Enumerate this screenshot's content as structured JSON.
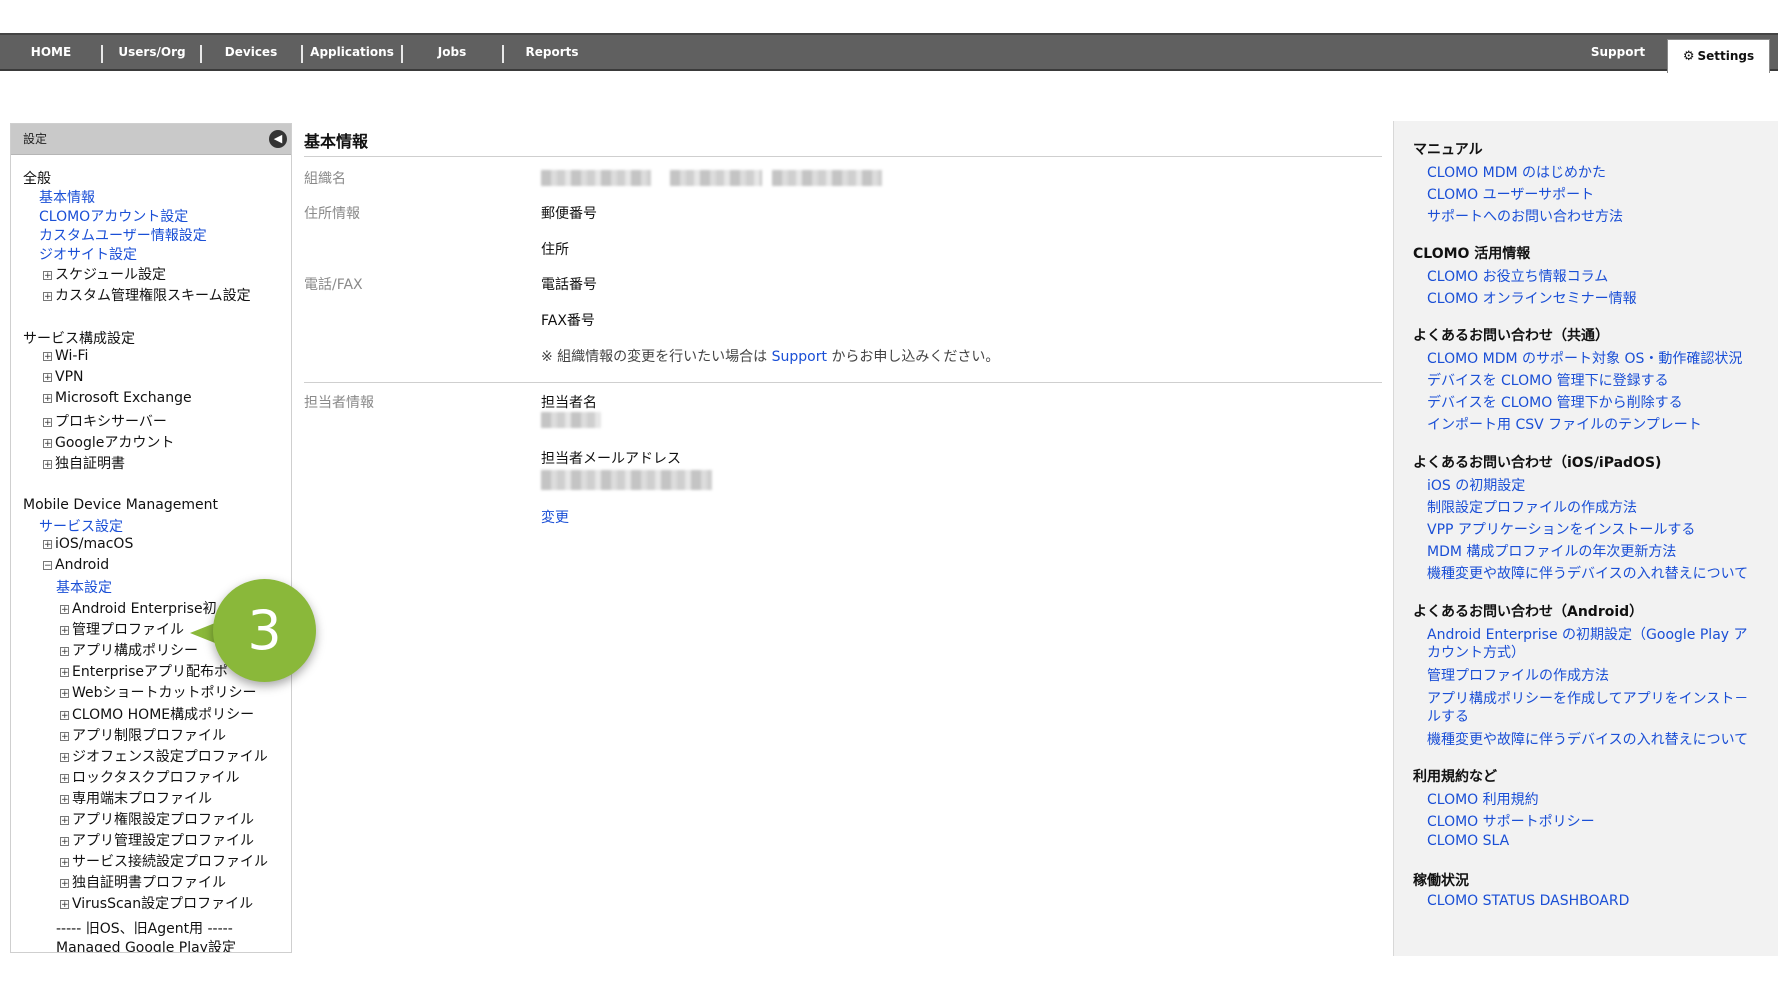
{
  "nav": {
    "items": [
      "HOME",
      "Users/Org",
      "Devices",
      "Applications",
      "Jobs",
      "Reports"
    ],
    "support": "Support",
    "settings": "Settings"
  },
  "sidebar": {
    "title": "設定",
    "general": {
      "heading": "全般",
      "links": [
        "基本情報",
        "CLOMOアカウント設定",
        "カスタムユーザー情報設定",
        "ジオサイト設定"
      ],
      "items": [
        "スケジュール設定",
        "カスタム管理権限スキーム設定"
      ]
    },
    "service": {
      "heading": "サービス構成設定",
      "items": [
        "Wi-Fi",
        "VPN",
        "Microsoft Exchange",
        "プロキシサーバー",
        "Googleアカウント",
        "独自証明書"
      ]
    },
    "mdm": {
      "heading": "Mobile Device Management",
      "service_link": "サービス設定",
      "ios": "iOS/macOS",
      "android": "Android",
      "android_basic": "基本設定",
      "android_items": [
        "Android Enterprise初",
        "管理プロファイル",
        "アプリ構成ポリシー",
        "Enterpriseアプリ配布ポ",
        "Webショートカットポリシー",
        "CLOMO HOME構成ポリシー",
        "アプリ制限プロファイル",
        "ジオフェンス設定プロファイル",
        "ロックタスクプロファイル",
        "専用端末プロファイル",
        "アプリ権限設定プロファイル",
        "アプリ管理設定プロファイル",
        "サービス接続設定プロファイル",
        "独自証明書プロファイル",
        "VirusScan設定プロファイル"
      ],
      "legacy_sep": "----- 旧OS、旧Agent用 -----",
      "managed_play": "Managed Google Play設定"
    }
  },
  "callout": "3",
  "main": {
    "title": "基本情報",
    "org_label": "組織名",
    "address_label": "住所情報",
    "postal": "郵便番号",
    "address": "住所",
    "phone_label": "電話/FAX",
    "phone": "電話番号",
    "fax": "FAX番号",
    "note_prefix": "※ 組織情報の変更を行いたい場合は",
    "note_link": "Support",
    "note_suffix": "からお申し込みください。",
    "contact_label": "担当者情報",
    "contact_name": "担当者名",
    "contact_email": "担当者メールアドレス",
    "change": "変更"
  },
  "right": {
    "sections": [
      {
        "heading": "マニュアル",
        "links": [
          "CLOMO MDM のはじめかた",
          "CLOMO ユーザーサポート",
          "サポートへのお問い合わせ方法"
        ]
      },
      {
        "heading": "CLOMO 活用情報",
        "links": [
          "CLOMO お役立ち情報コラム",
          "CLOMO オンラインセミナー情報"
        ]
      },
      {
        "heading": "よくあるお問い合わせ（共通）",
        "links": [
          "CLOMO MDM のサポート対象 OS・動作確認状況",
          "デバイスを CLOMO 管理下に登録する",
          "デバイスを CLOMO 管理下から削除する",
          "インポート用 CSV ファイルのテンプレート"
        ]
      },
      {
        "heading": "よくあるお問い合わせ（iOS/iPadOS)",
        "links": [
          "iOS の初期設定",
          "制限設定プロファイルの作成方法",
          "VPP アプリケーションをインストールする",
          "MDM 構成プロファイルの年次更新方法",
          "機種変更や故障に伴うデバイスの入れ替えについて"
        ]
      },
      {
        "heading": "よくあるお問い合わせ（Android）",
        "links": [
          "Android Enterprise の初期設定（Google Play ア",
          "カウント方式）",
          "管理プロファイルの作成方法",
          "アプリ構成ポリシーを作成してアプリをインスト－",
          "ルする",
          "機種変更や故障に伴うデバイスの入れ替えについて"
        ]
      },
      {
        "heading": "利用規約など",
        "links": [
          "CLOMO 利用規約",
          "CLOMO サポートポリシー",
          "CLOMO SLA"
        ]
      },
      {
        "heading": "稼働状況",
        "links": [
          "CLOMO STATUS DASHBOARD"
        ]
      }
    ]
  }
}
